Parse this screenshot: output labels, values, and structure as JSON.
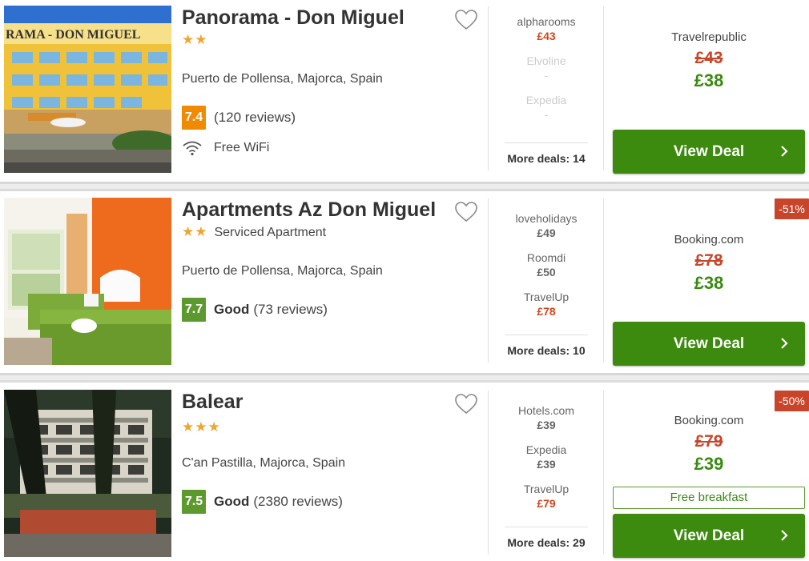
{
  "colors": {
    "star": "#f0a52f",
    "score_orange": "#f08a00",
    "score_green": "#5c9a2e",
    "price_red": "#c8462a",
    "price_green": "#3a8a12",
    "button_green": "#3c8a0e",
    "discount_red": "#c9452a"
  },
  "hotels": [
    {
      "name": "Panorama - Don Miguel",
      "stars": "★★",
      "stars_count": 2,
      "property_type": "",
      "location": "Puerto de Pollensa, Majorca, Spain",
      "score": "7.4",
      "score_word": "",
      "reviews": "(120 reviews)",
      "amenity": "Free WiFi",
      "amenity_icon": "wifi-icon",
      "sign_text": "RAMA - DON MIGUEL",
      "deals": [
        {
          "provider": "alpharooms",
          "price": "£43"
        },
        {
          "provider": "Elvoline",
          "price": "-"
        },
        {
          "provider": "Expedia",
          "price": "-"
        }
      ],
      "more_deals": "More deals: 14",
      "best_provider": "Travelrepublic",
      "old_price": "£43",
      "new_price": "£38",
      "discount": "",
      "extra": "",
      "button": "View Deal"
    },
    {
      "name": "Apartments Az Don Miguel",
      "stars": "★★",
      "stars_count": 2,
      "property_type": "Serviced Apartment",
      "location": "Puerto de Pollensa, Majorca, Spain",
      "score": "7.7",
      "score_word": "Good",
      "reviews": "(73 reviews)",
      "deals": [
        {
          "provider": "loveholidays",
          "price": "£49"
        },
        {
          "provider": "Roomdi",
          "price": "£50"
        },
        {
          "provider": "TravelUp",
          "price": "£78"
        }
      ],
      "more_deals": "More deals: 10",
      "best_provider": "Booking.com",
      "old_price": "£78",
      "new_price": "£38",
      "discount": "-51%",
      "extra": "",
      "button": "View Deal"
    },
    {
      "name": "Balear",
      "stars": "★★★",
      "stars_count": 3,
      "property_type": "",
      "location": "C'an Pastilla, Majorca, Spain",
      "score": "7.5",
      "score_word": "Good",
      "reviews": "(2380 reviews)",
      "deals": [
        {
          "provider": "Hotels.com",
          "price": "£39"
        },
        {
          "provider": "Expedia",
          "price": "£39"
        },
        {
          "provider": "TravelUp",
          "price": "£79"
        }
      ],
      "more_deals": "More deals: 29",
      "best_provider": "Booking.com",
      "old_price": "£79",
      "new_price": "£39",
      "discount": "-50%",
      "extra": "Free breakfast",
      "button": "View Deal"
    }
  ]
}
